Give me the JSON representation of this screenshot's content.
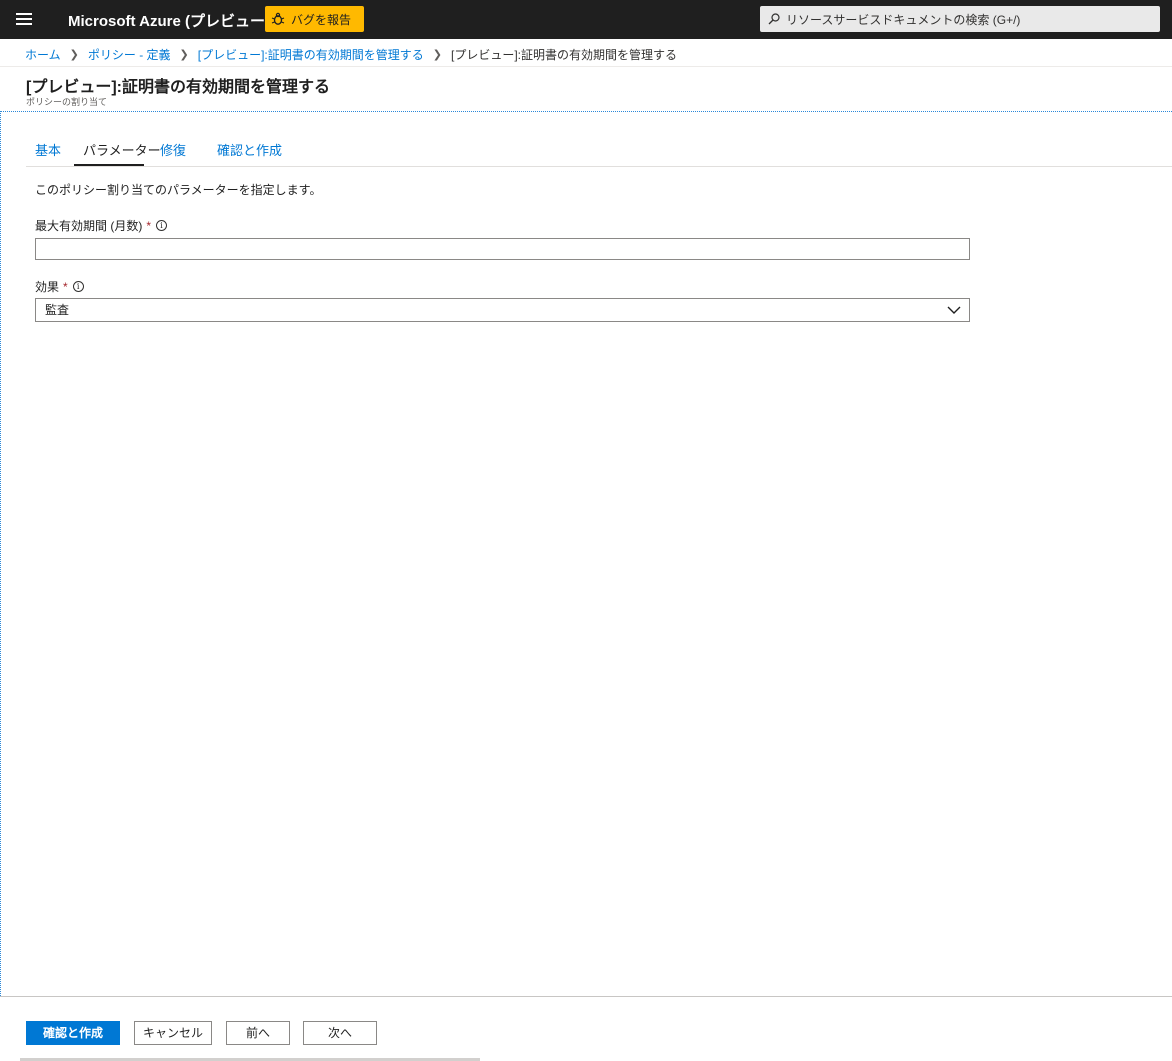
{
  "topbar": {
    "app_title": "Microsoft Azure (プレビュー)",
    "bug_button_label": "バグを報告",
    "bug_button_color": "#ffb900",
    "search_placeholder": "リソースサービスドキュメントの検索 (G+/)",
    "icons": [
      "hamburger-menu-icon",
      "bug-icon",
      "search-icon"
    ]
  },
  "breadcrumb": {
    "items": [
      "ホーム",
      "ポリシー - 定義",
      "[プレビュー]:証明書の有効期間を管理する"
    ],
    "current": "[プレビュー]:証明書の有効期間を管理する"
  },
  "header": {
    "title": "[プレビュー]:証明書の有効期間を管理する",
    "subtitle": "ポリシーの割り当て"
  },
  "tabs": [
    {
      "label": "基本",
      "active": false
    },
    {
      "label": "パラメーター",
      "active": true
    },
    {
      "label": "修復",
      "active": false
    },
    {
      "label": "確認と作成",
      "active": false
    }
  ],
  "form": {
    "description": "このポリシー割り当てのパラメーターを指定します。",
    "max_validity": {
      "label": "最大有効期間 (月数)",
      "required_mark": "*",
      "value": ""
    },
    "effect": {
      "label": "効果",
      "required_mark": "*",
      "selected": "監査"
    }
  },
  "footer": {
    "create_label": "確認と作成",
    "cancel_label": "キャンセル",
    "prev_label": "前へ",
    "next_label": "次へ"
  },
  "colors": {
    "accent": "#0078d4",
    "topbar": "#1f1f1f",
    "required": "#a4262c"
  }
}
